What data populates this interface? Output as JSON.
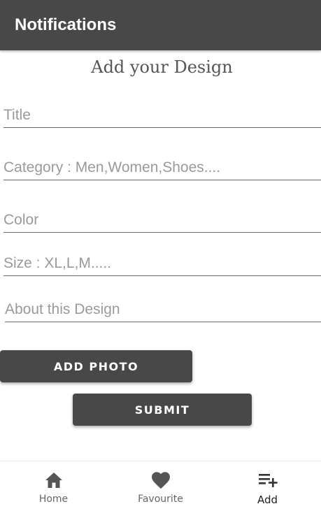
{
  "app_bar": {
    "title": "Notifications"
  },
  "form": {
    "heading": "Add your Design",
    "fields": {
      "title_placeholder": "Title",
      "category_placeholder": "Category : Men,Women,Shoes....",
      "color_placeholder": "Color",
      "size_placeholder": "Size : XL,L,M.....",
      "about_placeholder": "About this Design"
    },
    "add_photo_label": "ADD PHOTO",
    "submit_label": "SUBMIT"
  },
  "bottom_nav": {
    "items": [
      {
        "label": "Home",
        "icon": "home-icon"
      },
      {
        "label": "Favourite",
        "icon": "heart-icon"
      },
      {
        "label": "Add",
        "icon": "playlist-add-icon",
        "active": true
      }
    ]
  },
  "colors": {
    "primary": "#484848",
    "background": "#ffffff",
    "placeholder": "#9a9a9a"
  }
}
